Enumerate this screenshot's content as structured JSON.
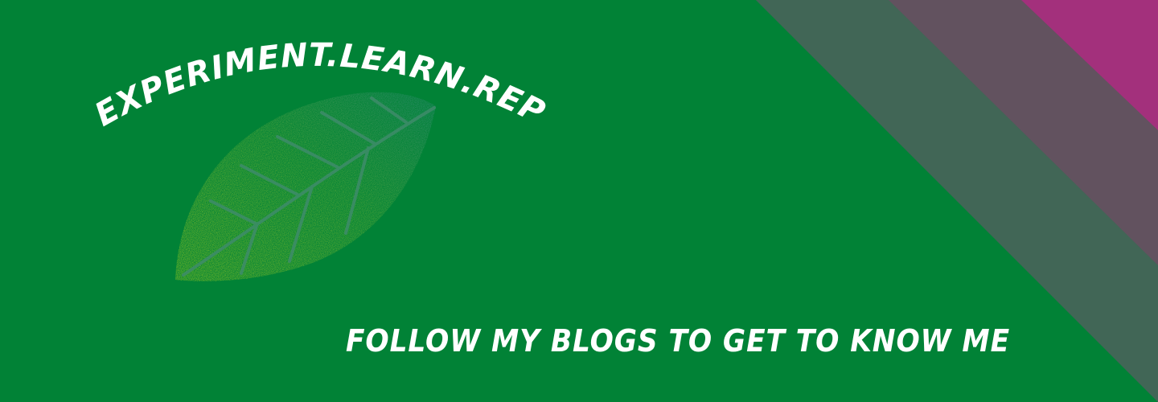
{
  "banner": {
    "tagline": "EXPERIMENT.LEARN.REPEAT.",
    "call_to_action": "FOLLOW MY BLOGS TO GET TO KNOW ME",
    "leaf_icon": "leaf-icon",
    "colors": {
      "background": "#018236",
      "stripe_outer": "#416656",
      "stripe_middle": "#62525F",
      "corner_magenta": "#A3307C",
      "leaf_light": "#C3DC1C",
      "leaf_mid": "#6FB43A",
      "leaf_dark": "#3D8A8C",
      "text": "#FFFFFF"
    }
  }
}
